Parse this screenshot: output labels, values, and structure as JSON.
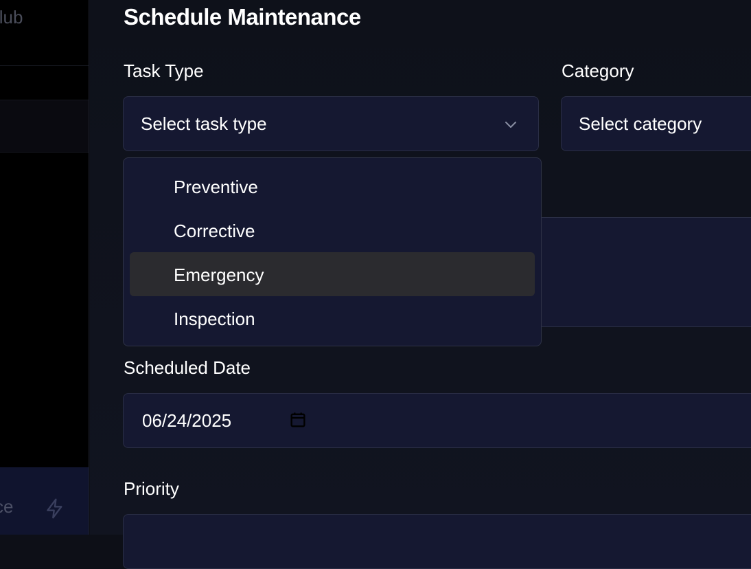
{
  "background": {
    "brand_fragment": "Club",
    "upgrade_fragment": "ce",
    "upgrade_icon": "bolt-icon"
  },
  "modal": {
    "title": "Schedule Maintenance",
    "task_type": {
      "label": "Task Type",
      "placeholder": "Select task type",
      "icon": "chevron-down-icon",
      "options": [
        {
          "label": "Preventive"
        },
        {
          "label": "Corrective"
        },
        {
          "label": "Emergency",
          "highlighted": true
        },
        {
          "label": "Inspection"
        }
      ]
    },
    "category": {
      "label": "Category",
      "placeholder": "Select category"
    },
    "scheduled_date": {
      "label": "Scheduled Date",
      "value": "06/24/2025",
      "icon": "calendar-icon"
    },
    "priority": {
      "label": "Priority"
    }
  },
  "colors": {
    "modal_bg": "#0e111a",
    "field_bg": "#151831",
    "field_border": "#2a2e45",
    "highlight_bg": "#2b2b2f",
    "text": "#ffffff"
  }
}
